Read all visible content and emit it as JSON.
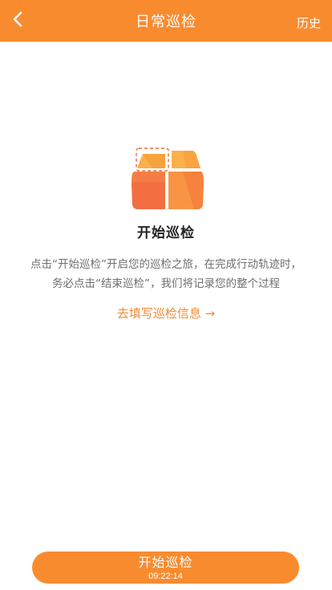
{
  "header": {
    "title": "日常巡检",
    "history_label": "历史",
    "back_icon": "chevron-left-icon",
    "background": "#f98b2f"
  },
  "hero": {
    "icon": "patrol-grid-icon",
    "title": "开始巡检"
  },
  "description": {
    "line1": "点击“开始巡检”开启您的巡检之旅，在完成行动轨迹时，",
    "line2": "务必点击“结束巡检”，我们将记录您的整个过程"
  },
  "fill_info_link": {
    "label": "去填写巡检信息 →"
  },
  "start_button": {
    "label": "开始巡检",
    "time": "09:22:14"
  },
  "colors": {
    "accent": "#f98b2f",
    "link": "#f58a30",
    "text_dark": "#222222",
    "text_gray": "#6e6e6e"
  }
}
